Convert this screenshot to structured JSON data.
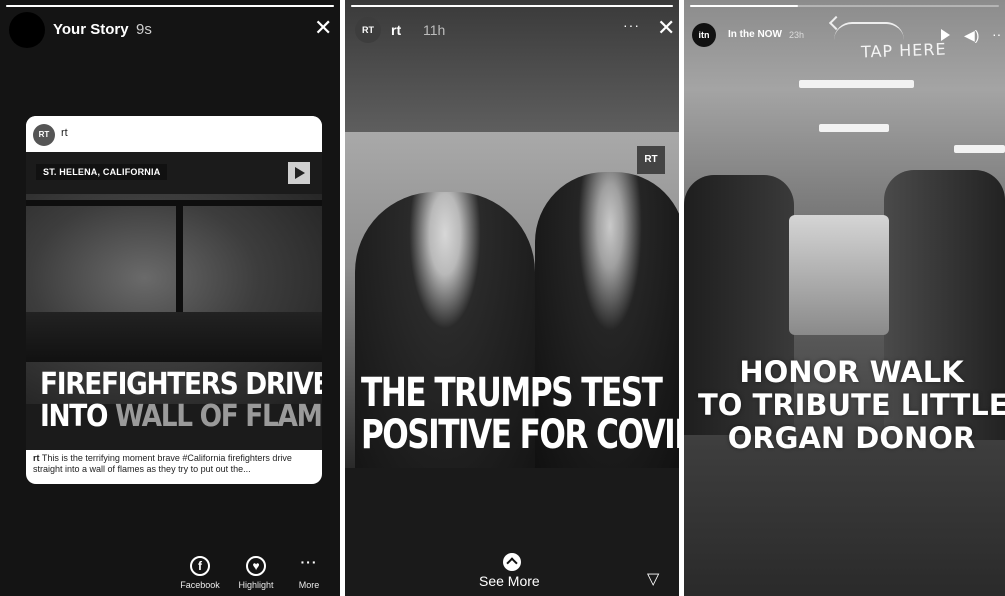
{
  "story1": {
    "username": "Your Story",
    "time": "9s",
    "progress": 1.0,
    "post": {
      "account": "rt",
      "logo_text": "RT",
      "location_tag": "ST. HELENA, CALIFORNIA",
      "headline_line1": "FIREFIGHTERS DRIVE",
      "headline_line2_a": "INTO",
      "headline_line2_b": "WALL OF FLAMES",
      "caption_account": "rt",
      "caption_text": "This is the terrifying moment brave #California firefighters drive straight into a wall of flames as they try to put out the..."
    },
    "actions": [
      {
        "label": "Facebook",
        "icon": "facebook-icon",
        "glyph": "f"
      },
      {
        "label": "Highlight",
        "icon": "heart-icon",
        "glyph": "♥"
      },
      {
        "label": "More",
        "icon": "more-icon",
        "glyph": "···"
      }
    ]
  },
  "story2": {
    "username": "rt",
    "logo_text": "RT",
    "time": "11h",
    "progress": 1.0,
    "badge_text": "RT",
    "headline_line1": "THE TRUMPS TEST",
    "headline_line2": "POSITIVE FOR COVID",
    "see_more": "See More"
  },
  "story3": {
    "username": "In the NOW",
    "logo_text": "itn",
    "time": "23h",
    "progress": 0.35,
    "annotation": "TAP HERE",
    "headline_line1": "HONOR WALK",
    "headline_line2": "TO TRIBUTE LITTLE",
    "headline_line3": "ORGAN DONOR"
  }
}
